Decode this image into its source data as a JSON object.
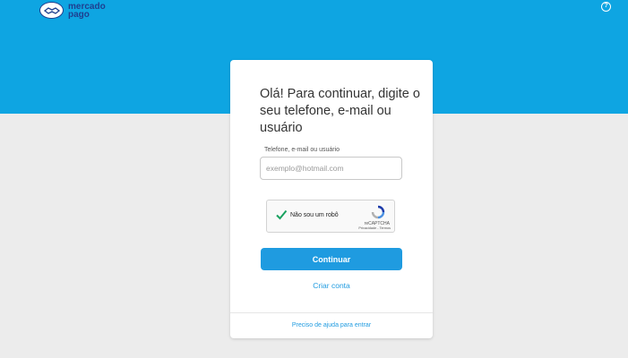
{
  "header": {
    "brand_line1": "mercado",
    "brand_line2": "pago",
    "help_icon": "?"
  },
  "login": {
    "title": "Olá! Para continuar, digite o seu telefone, e-mail ou usuário",
    "field_label": "Telefone, e-mail ou usuário",
    "field_placeholder": "exemplo@hotmail.com",
    "field_value": "",
    "captcha_label": "Não sou um robô",
    "captcha_brand": "reCAPTCHA",
    "captcha_links": "Privacidade - Termos",
    "submit_label": "Continuar",
    "create_account_label": "Criar conta",
    "help_link_label": "Preciso de ajuda para entrar"
  },
  "icons": {
    "logo": "handshake-logo-icon",
    "help": "question-circle-icon",
    "captcha_check": "checkmark-icon",
    "captcha_logo": "recaptcha-icon"
  },
  "colors": {
    "hero": "#0ea5e2",
    "background": "#ececec",
    "accent": "#1f9be0",
    "brand": "#1f3f8f",
    "check": "#1aa260"
  }
}
